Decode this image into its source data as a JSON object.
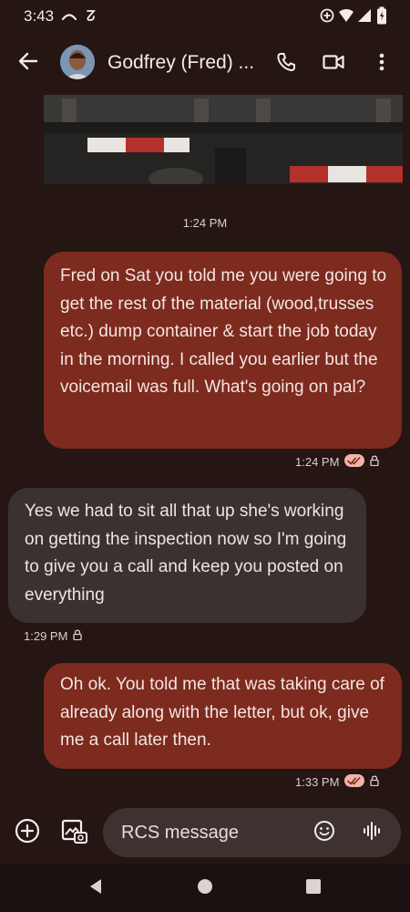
{
  "status_bar": {
    "time": "3:43"
  },
  "header": {
    "contact_name": "Godfrey (Fred) ..."
  },
  "messages": [
    {
      "timestamp": "1:24 PM"
    },
    {
      "text": "Fred on Sat you told me you were going to get the  rest of the material (wood,trusses etc.) dump  container &  start the job today in the morning. I called you earlier but the voicemail was full. What's going on pal?",
      "time": "1:24 PM"
    },
    {
      "text": "Yes we had to sit all that up she's working on getting the inspection now so I'm going to give you a call and keep you posted on everything",
      "time": "1:29 PM"
    },
    {
      "text": "Oh ok. You told me that was taking care of already along with the letter, but ok, give me a call later then.",
      "time": "1:33 PM"
    }
  ],
  "composer": {
    "placeholder": "RCS message"
  },
  "colors": {
    "background": "#251513",
    "outgoing_bubble": "#7d2a1f",
    "incoming_bubble": "#3a3230",
    "read_receipt": "#f2b3a8"
  }
}
